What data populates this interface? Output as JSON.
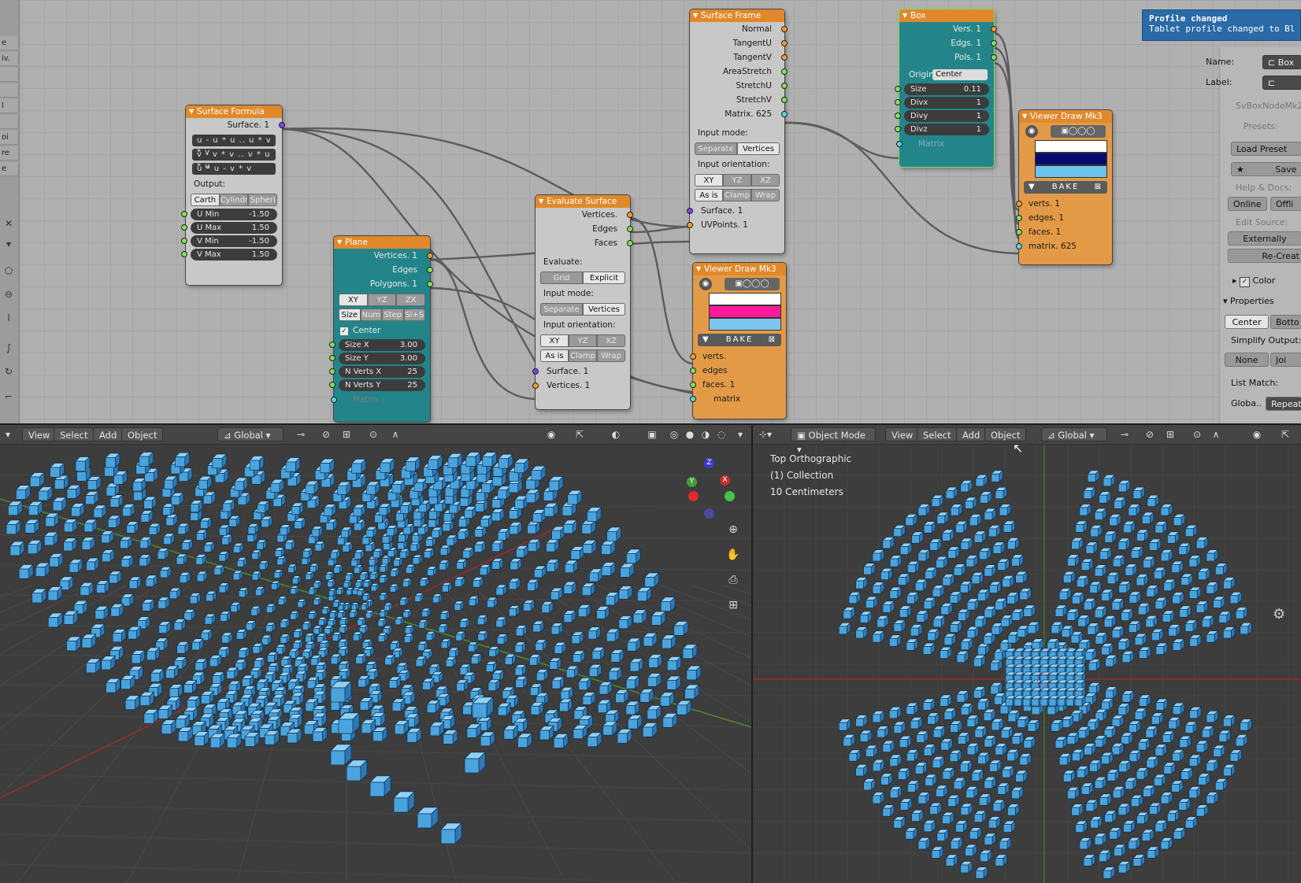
{
  "notification": {
    "title": "Profile changed",
    "body": "Tablet profile changed to Bl"
  },
  "left_toolbar": [
    "e",
    "iv.",
    "l",
    "oi",
    "re",
    "e"
  ],
  "nodes": {
    "surface_formula": {
      "title": "Surface Formula",
      "output": "Surface. 1",
      "formulas": [
        "u - u * u .. u * v * v",
        "v - v * v .. v * u * u",
        "u * u - v * v"
      ],
      "output_label": "Output:",
      "coord_buttons": [
        "Carth",
        "Cylindr",
        "Spheri"
      ],
      "fields": [
        {
          "label": "U Min",
          "value": "-1.50"
        },
        {
          "label": "U Max",
          "value": "1.50"
        },
        {
          "label": "V Min",
          "value": "-1.50"
        },
        {
          "label": "V Max",
          "value": "1.50"
        }
      ]
    },
    "plane": {
      "title": "Plane",
      "outputs": [
        "Vertices. 1",
        "Edges",
        "Polygons. 1"
      ],
      "axis_buttons": [
        "XY",
        "YZ",
        "ZX"
      ],
      "mode_buttons": [
        "Size",
        "Num",
        "Step",
        "Si+S"
      ],
      "center_label": "Center",
      "fields": [
        {
          "label": "Size X",
          "value": "3.00"
        },
        {
          "label": "Size Y",
          "value": "3.00"
        },
        {
          "label": "N Verts X",
          "value": "25"
        },
        {
          "label": "N Verts Y",
          "value": "25"
        }
      ],
      "matrix_label": "Matrix"
    },
    "evaluate_surface": {
      "title": "Evaluate Surface",
      "outputs": [
        "Vertices.",
        "Edges",
        "Faces"
      ],
      "evaluate_label": "Evaluate:",
      "evaluate_buttons": [
        "Grid",
        "Explicit"
      ],
      "input_mode_label": "Input mode:",
      "input_mode_buttons": [
        "Separate",
        "Vertices"
      ],
      "orientation_label": "Input orientation:",
      "axis_buttons": [
        "XY",
        "YZ",
        "XZ"
      ],
      "clamp_buttons": [
        "As is",
        "Clamp",
        "Wrap"
      ],
      "inputs": [
        "Surface. 1",
        "Vertices. 1"
      ]
    },
    "surface_frame": {
      "title": "Surface Frame",
      "outputs": [
        "Normal",
        "TangentU",
        "TangentV",
        "AreaStretch",
        "StretchU",
        "StretchV",
        "Matrix. 625"
      ],
      "input_mode_label": "Input mode:",
      "input_mode_buttons": [
        "Separate",
        "Vertices"
      ],
      "orientation_label": "Input orientation:",
      "axis_buttons": [
        "XY",
        "YZ",
        "XZ"
      ],
      "clamp_buttons": [
        "As is",
        "Clamp",
        "Wrap"
      ],
      "inputs": [
        "Surface. 1",
        "UVPoints. 1"
      ]
    },
    "viewer_a": {
      "title": "Viewer Draw Mk3",
      "bake": "BAKE",
      "inputs": [
        "verts.",
        "edges",
        "faces. 1",
        "matrix"
      ],
      "colors": [
        "#ffffff",
        "#ff1a9c",
        "#7cc6ee"
      ]
    },
    "box": {
      "title": "Box",
      "outputs": [
        "Vers. 1",
        "Edgs. 1",
        "Pols. 1"
      ],
      "origin_label": "Origin",
      "origin_value": "Center",
      "fields": [
        {
          "label": "Size",
          "value": "0.11"
        },
        {
          "label": "Divx",
          "value": "1"
        },
        {
          "label": "Divy",
          "value": "1"
        },
        {
          "label": "Divz",
          "value": "1"
        }
      ],
      "matrix_label": "Matrix"
    },
    "viewer_b": {
      "title": "Viewer Draw Mk3",
      "bake": "BAKE",
      "inputs": [
        "verts. 1",
        "edges. 1",
        "faces. 1",
        "matrix. 625"
      ],
      "colors": [
        "#ffffff",
        "#0a0a6e",
        "#6ec2ee"
      ]
    }
  },
  "properties": {
    "name_label": "Name:",
    "name_value": "Box",
    "label_label": "Label:",
    "node_id": "SvBoxNodeMk2",
    "presets_label": "Presets:",
    "load_preset": "Load Preset",
    "save": "Save",
    "help_label": "Help & Docs:",
    "online": "Online",
    "offline": "Offli",
    "edit_source_label": "Edit Source:",
    "externally": "Externally",
    "recreate": "Re-Creat",
    "color_label": "Color",
    "properties_label": "Properties",
    "center": "Center",
    "bottom": "Botto",
    "simplify_label": "Simplify Output:",
    "none": "None",
    "join": "Joi",
    "list_match_label": "List Match:",
    "global_label": "Globa..",
    "repeat": "Repeat"
  },
  "viewport_left": {
    "menu": [
      "View",
      "Select",
      "Add",
      "Object"
    ],
    "orientation": "Global"
  },
  "viewport_right": {
    "mode": "Object Mode",
    "menu": [
      "View",
      "Select",
      "Add",
      "Object"
    ],
    "orientation": "Global",
    "overlay": [
      "Top Orthographic",
      "(1) Collection",
      "10 Centimeters"
    ]
  },
  "gizmo": {
    "x": "X",
    "y": "Y",
    "z": "Z"
  },
  "colors": {
    "node_header": "#e0892c",
    "teal_node": "#23858a",
    "viewer_node": "#e39a46",
    "cube": "#4aa3dc",
    "notification": "#2a6aa6"
  }
}
